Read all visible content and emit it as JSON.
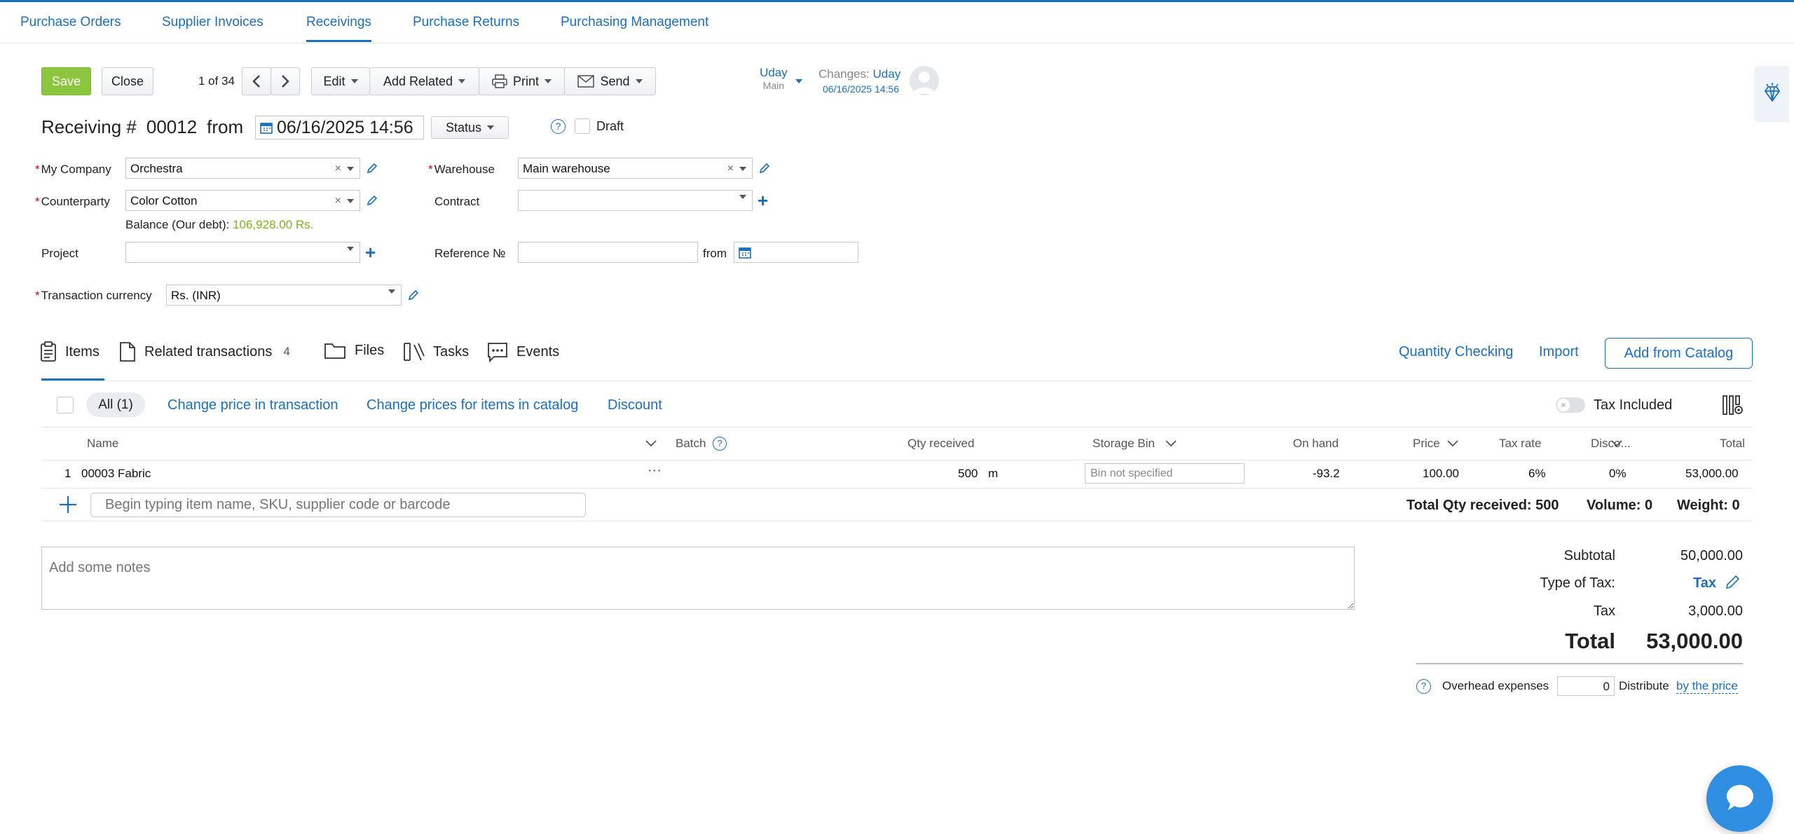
{
  "nav": {
    "tabs": [
      "Purchase Orders",
      "Supplier Invoices",
      "Receivings",
      "Purchase Returns",
      "Purchasing Management"
    ]
  },
  "toolbar": {
    "save": "Save",
    "close": "Close",
    "pager": "1 of 34",
    "edit": "Edit",
    "add_related": "Add Related",
    "print": "Print",
    "send": "Send"
  },
  "user": {
    "name": "Uday",
    "role": "Main",
    "changes_label": "Changes:",
    "changes_user": "Uday",
    "changes_date": "06/16/2025 14:56"
  },
  "doc": {
    "title": "Receiving #",
    "number": "00012",
    "from": "from",
    "date": "06/16/2025 14:56",
    "status": "Status",
    "draft": "Draft"
  },
  "form": {
    "my_company_label": "My Company",
    "my_company": "Orchestra",
    "counterparty_label": "Counterparty",
    "counterparty": "Color Cotton",
    "balance_label": "Balance (Our debt):",
    "balance_value": "106,928.00 Rs.",
    "project_label": "Project",
    "project": "",
    "currency_label": "Transaction currency",
    "currency": "Rs. (INR)",
    "warehouse_label": "Warehouse",
    "warehouse": "Main warehouse",
    "contract_label": "Contract",
    "contract": "",
    "reference_label": "Reference №",
    "reference": "",
    "ref_from": "from"
  },
  "tabs": {
    "items": "Items",
    "related": "Related transactions",
    "related_count": "4",
    "files": "Files",
    "tasks": "Tasks",
    "events": "Events",
    "quantity_checking": "Quantity Checking",
    "import": "Import",
    "add_from_catalog": "Add from Catalog"
  },
  "filters": {
    "all": "All (1)",
    "change_price": "Change price in transaction",
    "change_catalog": "Change prices for items in catalog",
    "discount": "Discount",
    "tax_included": "Tax Included"
  },
  "table": {
    "headers": {
      "name": "Name",
      "batch": "Batch",
      "qty": "Qty received",
      "bin": "Storage Bin",
      "on_hand": "On hand",
      "price": "Price",
      "tax_rate": "Tax rate",
      "discount": "Disco...",
      "total": "Total"
    },
    "rows": [
      {
        "index": "1",
        "name": "00003 Fabric",
        "more": "···",
        "qty": "500",
        "unit": "m",
        "bin": "Bin not specified",
        "on_hand": "-93.2",
        "price": "100.00",
        "tax_rate": "6%",
        "discount": "0%",
        "total": "53,000.00"
      }
    ],
    "add_placeholder": "Begin typing item name, SKU, supplier code or barcode",
    "total_qty": "Total Qty received: 500",
    "volume": "Volume: 0",
    "weight": "Weight: 0"
  },
  "notes": {
    "placeholder": "Add some notes"
  },
  "summary": {
    "subtotal_label": "Subtotal",
    "subtotal": "50,000.00",
    "type_of_tax_label": "Type of Tax:",
    "type_of_tax": "Tax",
    "tax_label": "Tax",
    "tax": "3,000.00",
    "total_label": "Total",
    "total": "53,000.00",
    "overhead_label": "Overhead expenses",
    "overhead_value": "0",
    "distribute_label": "Distribute",
    "distribute_link": "by the price"
  },
  "colors": {
    "accent": "#1a6fbf",
    "save": "#8cc63f",
    "balance": "#7cb518",
    "chat": "#2f8ee0"
  }
}
